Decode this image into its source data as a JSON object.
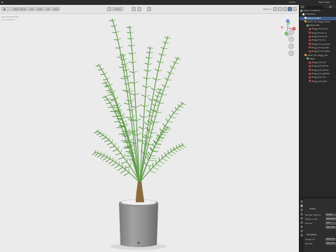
{
  "topbar": {
    "scene_label": "Scene",
    "view_layer_label": "View Layer"
  },
  "viewport": {
    "header": {
      "mode_label": "Object Mode",
      "menus": [
        "View",
        "Select",
        "Add",
        "Object"
      ],
      "orientation_label": "Global",
      "options_label": "Options"
    },
    "overlay_text": [
      "User Perspective",
      "(1) Collection"
    ],
    "gizmo_axes": [
      "X",
      "Y",
      "Z"
    ]
  },
  "outliner": {
    "rows": [
      {
        "label": "Scene Collection",
        "color": "#9b9b9b",
        "selected": false,
        "indent": 0
      },
      {
        "label": "Collection",
        "color": "#e6e6e6",
        "selected": false,
        "indent": 1
      },
      {
        "label": "PALM_PLANT",
        "color": "#e6e6e6",
        "selected": true,
        "indent": 2
      },
      {
        "label": "plant_TH_Zogg_Grass",
        "color": "#f0a030",
        "selected": false,
        "indent": 2
      },
      {
        "label": "Mesh.001",
        "color": "#6fb06f",
        "selected": false,
        "indent": 3
      },
      {
        "label": "Zogg_Frond_rm",
        "color": "#c64040",
        "selected": false,
        "indent": 4
      },
      {
        "label": "Zogg_Frond_m",
        "color": "#c64040",
        "selected": false,
        "indent": 4
      },
      {
        "label": "Zogg_Frond_lm",
        "color": "#c64040",
        "selected": false,
        "indent": 4
      },
      {
        "label": "Zogg_Frond_s",
        "color": "#c64040",
        "selected": false,
        "indent": 4
      },
      {
        "label": "Zogg_Frond_trunk",
        "color": "#c64040",
        "selected": false,
        "indent": 4
      },
      {
        "label": "Zogg_Frond_leaf",
        "color": "#c64040",
        "selected": false,
        "indent": 4
      },
      {
        "label": "Zogg_Frond_base",
        "color": "#c64040",
        "selected": false,
        "indent": 4
      },
      {
        "label": "plant_TH_Zogg_pot",
        "color": "#f0a030",
        "selected": false,
        "indent": 2
      },
      {
        "label": "Mesh",
        "color": "#6fb06f",
        "selected": false,
        "indent": 3
      },
      {
        "label": "Zogg_pot_soil",
        "color": "#c64040",
        "selected": false,
        "indent": 4
      },
      {
        "label": "Zogg_pot_stone",
        "color": "#c64040",
        "selected": false,
        "indent": 4
      },
      {
        "label": "Zogg_pot_ceram",
        "color": "#c64040",
        "selected": false,
        "indent": 4
      },
      {
        "label": "Zogg_pot_pebble",
        "color": "#c64040",
        "selected": false,
        "indent": 4
      },
      {
        "label": "Zogg_pot_rim",
        "color": "#c64040",
        "selected": false,
        "indent": 4
      },
      {
        "label": "Zogg_pot_gold",
        "color": "#c64040",
        "selected": false,
        "indent": 4
      }
    ]
  },
  "properties": {
    "title": "Scene",
    "fields": [
      {
        "label": "Render Engine",
        "value": "Cycles"
      },
      {
        "label": "Feature Set",
        "value": "Supported"
      },
      {
        "label": "Device",
        "value": "GPU"
      },
      {
        "label": "",
        "value": "Open Sha"
      },
      {
        "label": "Sampling",
        "value": ""
      },
      {
        "label": "Viewport",
        "value": "Noise Thr"
      },
      {
        "label": "Render",
        "value": "Noise Thr"
      }
    ]
  }
}
